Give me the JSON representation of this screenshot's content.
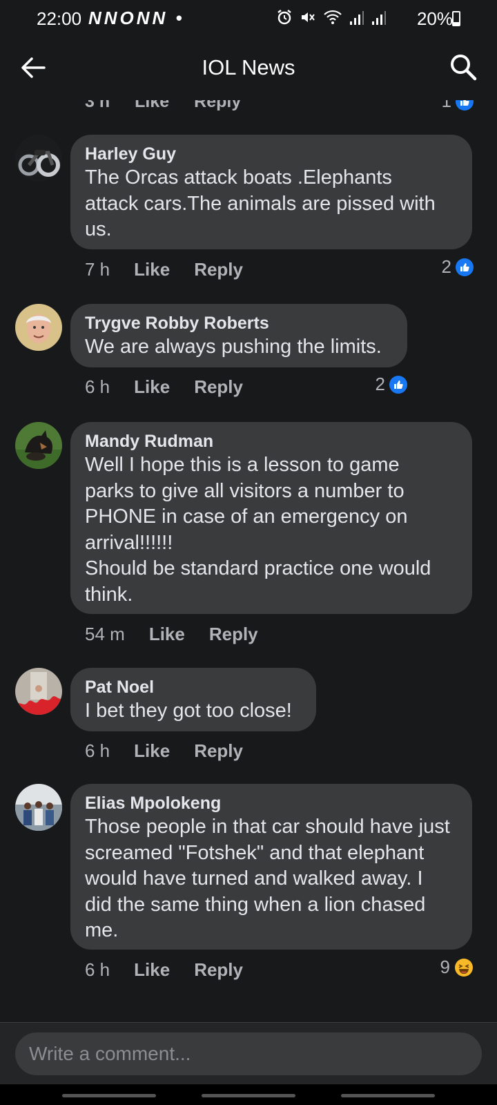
{
  "status": {
    "time": "22:00",
    "notifications": "NNONN •",
    "battery": "20%",
    "icons": [
      "alarm-icon",
      "mute-icon",
      "wifi-icon",
      "signal-icon",
      "signal-icon",
      "battery-icon"
    ]
  },
  "appbar": {
    "title": "IOL News",
    "back_icon": "back-arrow-icon",
    "search_icon": "search-icon"
  },
  "top_stub": {
    "time": "3 h",
    "like": "Like",
    "reply": "Reply",
    "count": "1"
  },
  "comments": [
    {
      "author": "Harley Guy",
      "text": "The Orcas attack boats .Elephants\nattack cars.The animals are pissed with\nus.",
      "time": "7 h",
      "like": "Like",
      "reply": "Reply",
      "reaction_count": "2",
      "reaction": "like-icon"
    },
    {
      "author": "Trygve Robby Roberts",
      "text": "We are always pushing the limits.",
      "time": "6 h",
      "like": "Like",
      "reply": "Reply",
      "reaction_count": "2",
      "reaction": "like-icon"
    },
    {
      "author": "Mandy Rudman",
      "text": "Well I hope this is a lesson to game\nparks to give all visitors a number to\nPHONE in case of an emergency on\narrival!!!!!!\nShould be standard practice one would\nthink.",
      "time": "54 m",
      "like": "Like",
      "reply": "Reply",
      "reaction_count": "",
      "reaction": ""
    },
    {
      "author": "Pat Noel",
      "text": "I bet they got too close!",
      "time": "6 h",
      "like": "Like",
      "reply": "Reply",
      "reaction_count": "",
      "reaction": ""
    },
    {
      "author": "Elias Mpolokeng",
      "text": "Those people in that car should have just\nscreamed \"Fotshek\" and that elephant\nwould have turned and walked away. I\ndid the same thing when a lion chased\nme.",
      "time": "6 h",
      "like": "Like",
      "reply": "Reply",
      "reaction_count": "9",
      "reaction": "haha-icon"
    }
  ],
  "composer": {
    "placeholder": "Write a comment..."
  },
  "colors": {
    "background": "#18191a",
    "bubble": "#3a3b3c",
    "like_blue": "#1877f2",
    "muted_text": "#b0b3b8"
  }
}
